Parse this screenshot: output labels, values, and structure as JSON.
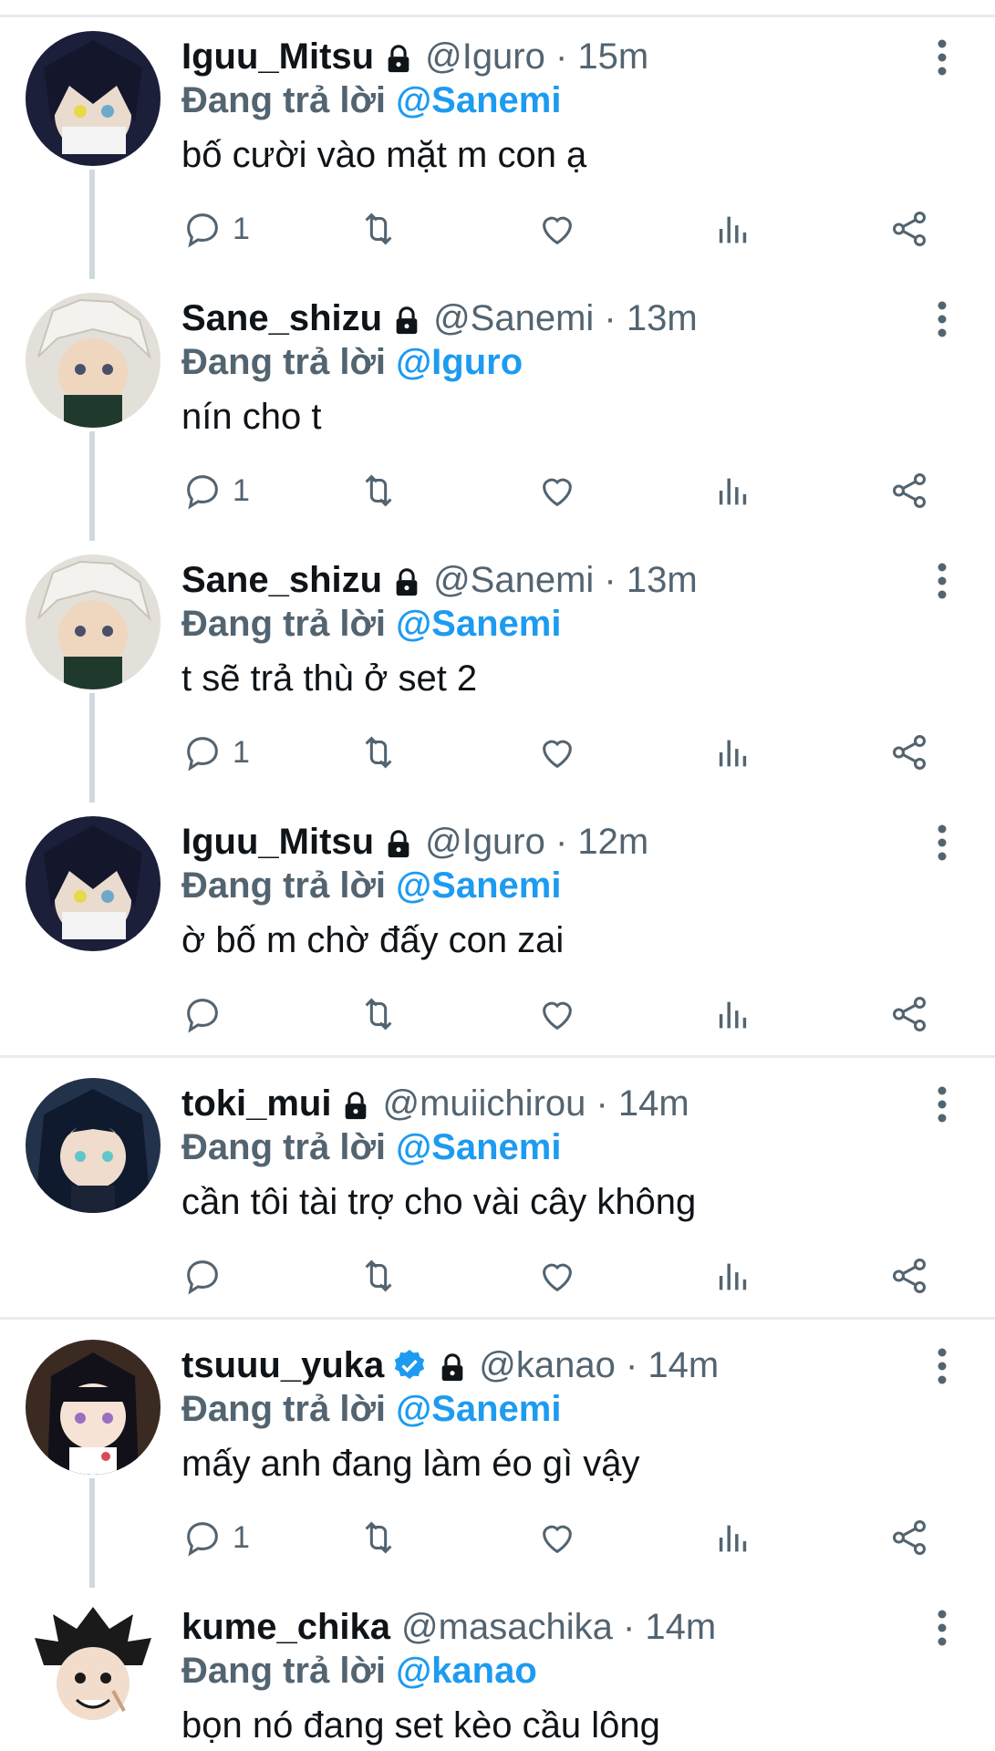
{
  "colors": {
    "accent": "#1d9bf0",
    "muted": "#536471",
    "text": "#0f1419",
    "thread_line": "#cfd9de"
  },
  "reply_prefix": "Đang trả lời",
  "tweets": [
    {
      "name": "Iguu_Mitsu",
      "locked": true,
      "verified": false,
      "handle": "@Iguro · 15m",
      "reply_to": "@Sanemi",
      "text": "bố cười vào mặt m con ạ",
      "reply_count": "1",
      "avatar": "iguro-avatar"
    },
    {
      "name": "Sane_shizu",
      "locked": true,
      "verified": false,
      "handle": "@Sanemi · 13m",
      "reply_to": "@Iguro",
      "text": "nín cho t",
      "reply_count": "1",
      "avatar": "sanemi-avatar"
    },
    {
      "name": "Sane_shizu",
      "locked": true,
      "verified": false,
      "handle": "@Sanemi · 13m",
      "reply_to": "@Sanemi",
      "text": "t sẽ trả thù ở set 2",
      "reply_count": "1",
      "avatar": "sanemi-avatar"
    },
    {
      "name": "Iguu_Mitsu",
      "locked": true,
      "verified": false,
      "handle": "@Iguro · 12m",
      "reply_to": "@Sanemi",
      "text": "ờ bố m chờ đấy con zai",
      "reply_count": "",
      "avatar": "iguro-avatar"
    },
    {
      "name": "toki_mui",
      "locked": true,
      "verified": false,
      "handle": "@muiichirou · 14m",
      "reply_to": "@Sanemi",
      "text": "cần tôi tài trợ cho vài cây không",
      "reply_count": "",
      "avatar": "muichiro-avatar"
    },
    {
      "name": "tsuuu_yuka",
      "locked": true,
      "verified": true,
      "handle": "@kanao · 14m",
      "reply_to": "@Sanemi",
      "text": "mấy anh đang làm éo gì vậy",
      "reply_count": "1",
      "avatar": "kanao-avatar"
    },
    {
      "name": "kume_chika",
      "locked": false,
      "verified": false,
      "handle": "@masachika · 14m",
      "reply_to": "@kanao",
      "text": "bọn nó đang set kèo cầu lông",
      "reply_count": "",
      "avatar": "masachika-avatar"
    }
  ]
}
